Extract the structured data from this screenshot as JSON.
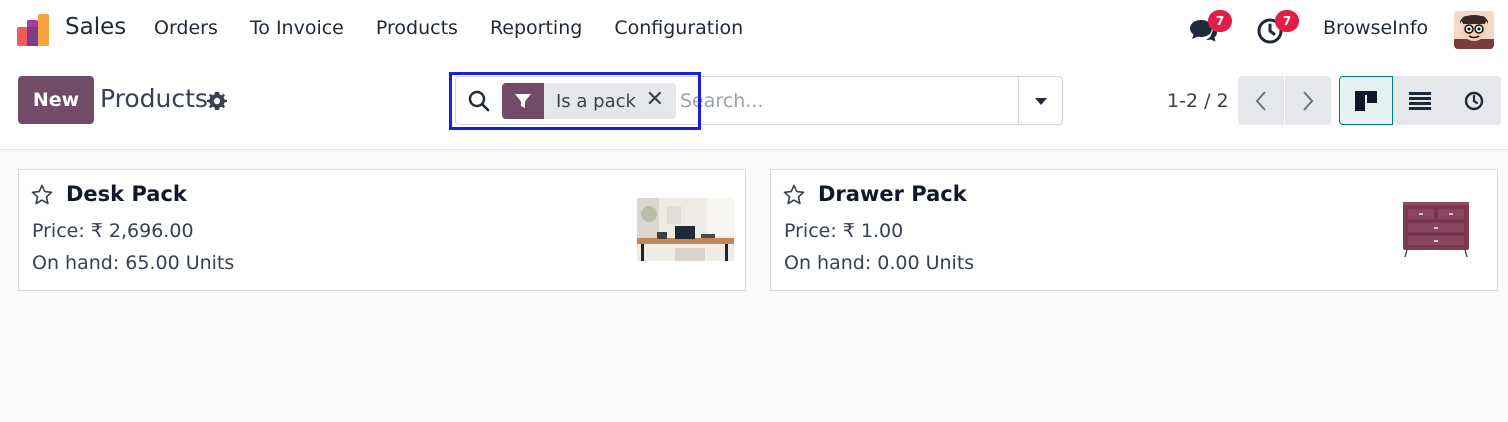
{
  "navbar": {
    "app_name": "Sales",
    "menu": [
      "Orders",
      "To Invoice",
      "Products",
      "Reporting",
      "Configuration"
    ],
    "chat_count": "7",
    "activity_count": "7",
    "company": "BrowseInfo"
  },
  "control": {
    "new_label": "New",
    "title": "Products",
    "search": {
      "facet_label": "Is a pack",
      "facet_remove": "✕",
      "placeholder": "Search..."
    },
    "pager": "1-2 / 2",
    "active_view": "kanban"
  },
  "products": [
    {
      "name": "Desk Pack",
      "price": "Price: ₹ 2,696.00",
      "on_hand": "On hand: 65.00 Units",
      "image": "desk-photo"
    },
    {
      "name": "Drawer Pack",
      "price": "Price: ₹ 1.00",
      "on_hand": "On hand: 0.00 Units",
      "image": "drawer-photo"
    }
  ],
  "colors": {
    "brand": "#714b67",
    "badge": "#e11d48",
    "highlight": "#1d1de0",
    "active_view": "#017e84"
  }
}
